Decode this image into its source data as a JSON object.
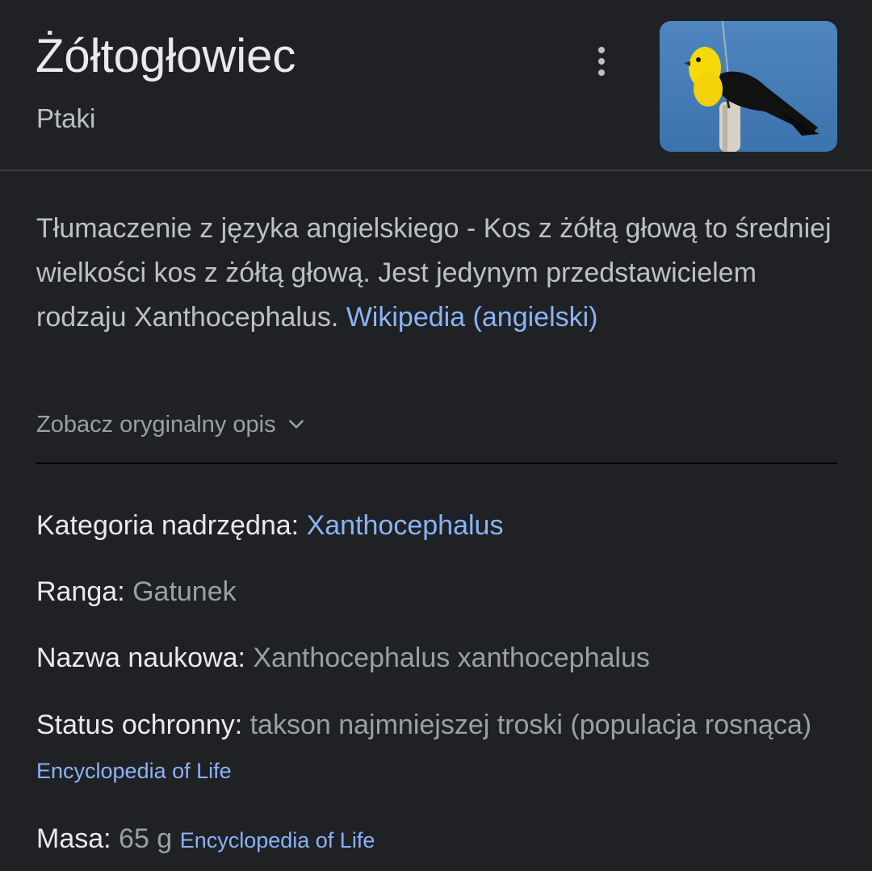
{
  "header": {
    "title": "Żółtogłowiec",
    "subtitle": "Ptaki",
    "more_icon": "more-vert-icon"
  },
  "description": {
    "text": "Tłumaczenie z języka angielskiego - Kos z żółtą głową to średniej wielkości kos z żółtą głową. Jest jedynym przedstawicielem rodzaju Xanthocephalus.",
    "source_link": "Wikipedia (angielski)"
  },
  "see_original": {
    "label": "Zobacz oryginalny opis",
    "icon": "chevron-down-icon"
  },
  "facts": {
    "parent": {
      "label": "Kategoria nadrzędna:",
      "value": "Xanthocephalus"
    },
    "rank": {
      "label": "Ranga:",
      "value": "Gatunek"
    },
    "scientific_name": {
      "label": "Nazwa naukowa:",
      "value": "Xanthocephalus xanthocephalus"
    },
    "conservation": {
      "label": "Status ochronny:",
      "value": "takson najmniejszej troski (populacja rosnąca)",
      "source": "Encyclopedia of Life"
    },
    "mass": {
      "label": "Masa:",
      "value": "65 g",
      "source": "Encyclopedia of Life"
    }
  },
  "colors": {
    "background": "#202124",
    "text_primary": "#e8eaed",
    "text_secondary": "#9aa0a6",
    "link": "#8ab4f8"
  }
}
